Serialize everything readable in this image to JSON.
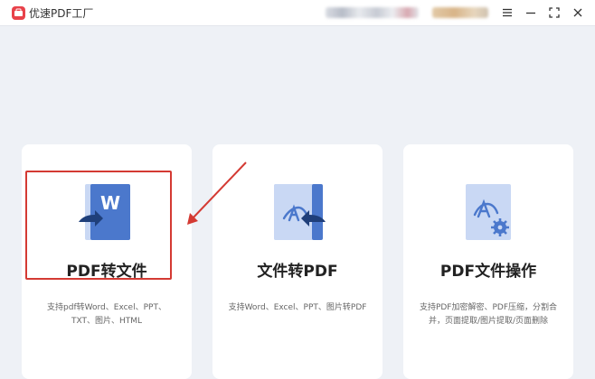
{
  "app": {
    "title": "优速PDF工厂",
    "logo_icon": "app-logo-icon",
    "brand_color": "#e8424a"
  },
  "window_controls": [
    {
      "name": "menu-icon"
    },
    {
      "name": "minimize-icon"
    },
    {
      "name": "maximize-icon"
    },
    {
      "name": "close-icon"
    }
  ],
  "cards": [
    {
      "title": "PDF转文件",
      "desc": "支持pdf转Word、Excel、PPT、TXT、图片、HTML",
      "icon": "pdf-to-word-icon",
      "selected": true
    },
    {
      "title": "文件转PDF",
      "desc": "支持Word、Excel、PPT、图片转PDF",
      "icon": "file-to-pdf-icon",
      "selected": false
    },
    {
      "title": "PDF文件操作",
      "desc": "支持PDF加密解密、PDF压缩，分割合并，页面提取/图片提取/页面删除",
      "icon": "pdf-operation-icon",
      "selected": false
    }
  ],
  "colors": {
    "icon_blue": "#4b78cc",
    "icon_light": "#c9d8f4",
    "highlight_red": "#d43a33",
    "background": "#eef1f6"
  }
}
